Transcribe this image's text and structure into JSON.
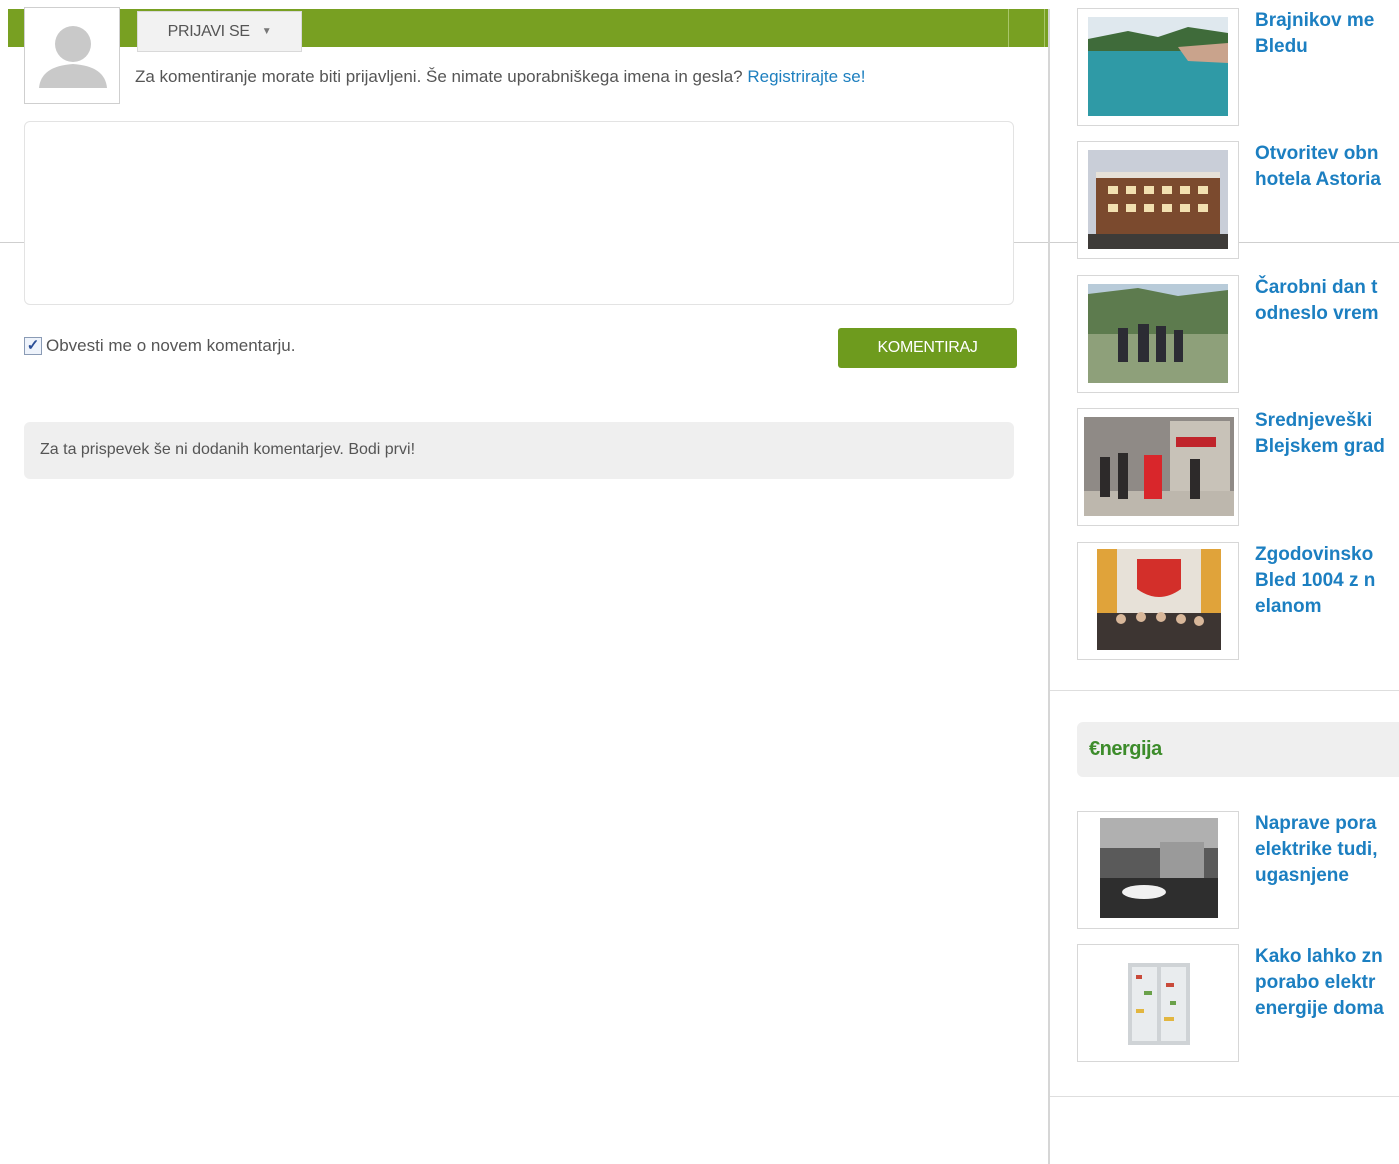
{
  "login": {
    "button_label": "PRIJAVI SE",
    "caret_icon": "caret-down-icon",
    "note": "Za komentiranje morate biti prijavljeni. Še nimate uporabniškega imena in gesla?",
    "register_link": "Registrirajte se!"
  },
  "comment": {
    "placeholder": "",
    "notify_label": "Obvesti me o novem komentarju.",
    "notify_checked": true,
    "submit_label": "KOMENTIRAJ",
    "empty_message": "Za ta prispevek še ni dodanih komentarjev. Bodi prvi!"
  },
  "sidebar": {
    "articles": [
      {
        "line1": "Brajnikov me",
        "line2": "Bledu",
        "line3": ""
      },
      {
        "line1": "Otvoritev obn",
        "line2": "hotela Astoria",
        "line3": ""
      },
      {
        "line1": "Čarobni dan t",
        "line2": "odneslo vrem",
        "line3": ""
      },
      {
        "line1": "Srednjeveški",
        "line2": "Blejskem grad",
        "line3": ""
      },
      {
        "line1": "Zgodovinsko",
        "line2": "Bled 1004 z n",
        "line3": "elanom"
      }
    ],
    "section_title": "€nergija",
    "energy_articles": [
      {
        "line1": "Naprave pora",
        "line2": "elektrike tudi,",
        "line3": "ugasnjene"
      },
      {
        "line1": "Kako lahko zn",
        "line2": "porabo elektr",
        "line3": "energije doma"
      }
    ]
  },
  "colors": {
    "brand_green": "#78a022",
    "button_green": "#6e9b1e",
    "link_blue": "#1c7fc1",
    "energija_green": "#3d8c2b"
  }
}
